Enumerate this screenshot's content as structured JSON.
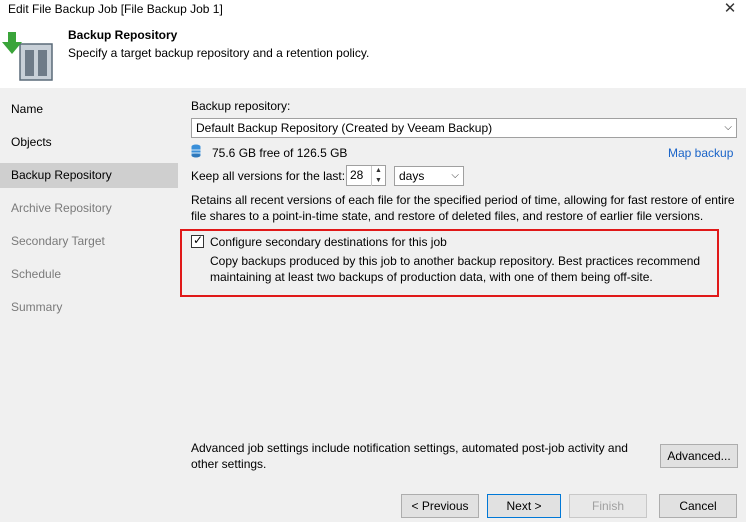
{
  "window": {
    "title": "Edit File Backup Job [File Backup Job 1]",
    "close_glyph": "✕"
  },
  "header": {
    "title": "Backup Repository",
    "subtitle": "Specify a target backup repository and a retention policy.",
    "icon": "backup-repository-icon"
  },
  "sidebar": {
    "items": [
      {
        "label": "Name",
        "state": "enabled"
      },
      {
        "label": "Objects",
        "state": "enabled"
      },
      {
        "label": "Backup Repository",
        "state": "selected"
      },
      {
        "label": "Archive Repository",
        "state": "disabled"
      },
      {
        "label": "Secondary Target",
        "state": "disabled"
      },
      {
        "label": "Schedule",
        "state": "disabled"
      },
      {
        "label": "Summary",
        "state": "disabled"
      }
    ]
  },
  "main": {
    "repo_label": "Backup repository:",
    "repo_value": "Default Backup Repository (Created by Veeam Backup)",
    "free_space": "75.6 GB free of 126.5 GB",
    "map_backup": "Map backup",
    "keep_label": "Keep all versions for the last:",
    "keep_value": "28",
    "keep_unit": "days",
    "retention_desc": "Retains all recent versions of each file for the specified period of time, allowing for fast restore of entire file shares to a point-in-time state, and restore of deleted files, and restore of earlier file versions.",
    "retain_line1": "Retains all recent versions of each file for the specified period of time, allowing for fast restore of entire",
    "retain_line2": "file shares to a point-in-time state, and restore of deleted files, and restore of earlier file versions.",
    "secondary": {
      "checked": true,
      "label": "Configure secondary destinations for this job",
      "desc_line1": "Copy backups produced by this job to another backup repository. Best practices recommend",
      "desc_line2": "maintaining at least two backups of production data, with one of them being off-site."
    },
    "advanced_line1": "Advanced job settings include notification settings, automated post-job activity and",
    "advanced_line2": "other settings.",
    "advanced_button": "Advanced..."
  },
  "footer": {
    "previous": "< Previous",
    "next": "Next >",
    "finish": "Finish",
    "cancel": "Cancel"
  },
  "colors": {
    "highlight_border": "#e01818",
    "link": "#1a64c8",
    "selected_nav": "#cfcfcf",
    "panel_bg": "#f0f0f0"
  }
}
